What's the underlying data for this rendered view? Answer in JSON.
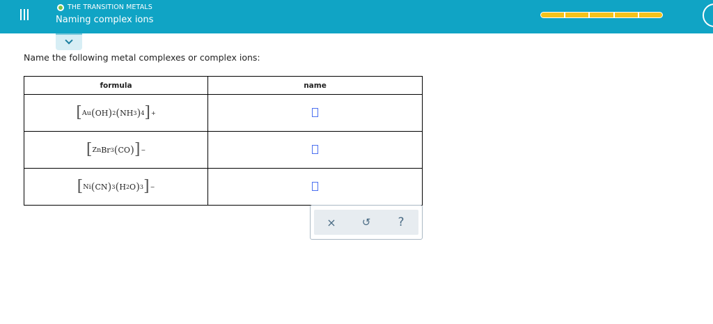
{
  "header": {
    "topic": "THE TRANSITION METALS",
    "lesson_title": "Naming complex ions",
    "progress_segments": 5,
    "progress_complete": 5,
    "accent_color": "#10a4c5",
    "progress_color": "#f5c21b",
    "topic_dot_color": "#7cc243"
  },
  "prompt": "Name the following metal complexes or complex ions:",
  "table": {
    "headers": {
      "formula": "formula",
      "name": "name"
    },
    "rows": [
      {
        "parts": {
          "metal": "Au",
          "l1": "OH",
          "l1_sub": "2",
          "l2": "NH",
          "l2_inner_sub": "3",
          "l2_sub": "4",
          "charge": "+"
        }
      },
      {
        "parts": {
          "metal": "Zn",
          "l1": "Br",
          "l1_sub": "3",
          "l2": "CO",
          "charge": "−"
        }
      },
      {
        "parts": {
          "metal": "Ni",
          "l1": "CN",
          "l1_sub": "3",
          "l2_a": "H",
          "l2_a_sub": "2",
          "l2_b": "O",
          "l2_sub": "3",
          "charge": "−"
        }
      }
    ]
  },
  "tools": {
    "clear": "×",
    "undo": "↺",
    "help": "?"
  }
}
